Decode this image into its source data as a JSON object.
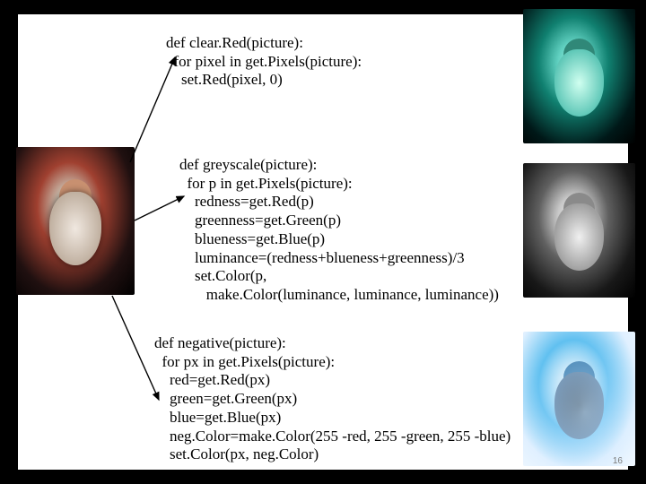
{
  "page_number": "16",
  "code_blocks": {
    "clear_red": "def clear.Red(picture):\n  for pixel in get.Pixels(picture):\n    set.Red(pixel, 0)",
    "greyscale": "def greyscale(picture):\n  for p in get.Pixels(picture):\n    redness=get.Red(p)\n    greenness=get.Green(p)\n    blueness=get.Blue(p)\n    luminance=(redness+blueness+greenness)/3\n    set.Color(p,\n       make.Color(luminance, luminance, luminance))",
    "negative": "def negative(picture):\n  for px in get.Pixels(picture):\n    red=get.Red(px)\n    green=get.Green(px)\n    blue=get.Blue(px)\n    neg.Color=make.Color(255 -red, 255 -green, 255 -blue)\n    set.Color(px, neg.Color)"
  },
  "images": {
    "source": {
      "name": "original-image",
      "effect": "original",
      "description": "Santa Claus color photograph"
    },
    "results": [
      {
        "name": "result-clear-red",
        "effect": "teal",
        "description": "Red channel removed (cyan/teal tint)"
      },
      {
        "name": "result-greyscale",
        "effect": "grey",
        "description": "Greyscale conversion"
      },
      {
        "name": "result-negative",
        "effect": "neg",
        "description": "Color negative"
      }
    ]
  },
  "arrows": [
    {
      "from": "source-image",
      "to": "code-clear-red"
    },
    {
      "from": "source-image",
      "to": "code-greyscale"
    },
    {
      "from": "source-image",
      "to": "code-negative"
    }
  ]
}
